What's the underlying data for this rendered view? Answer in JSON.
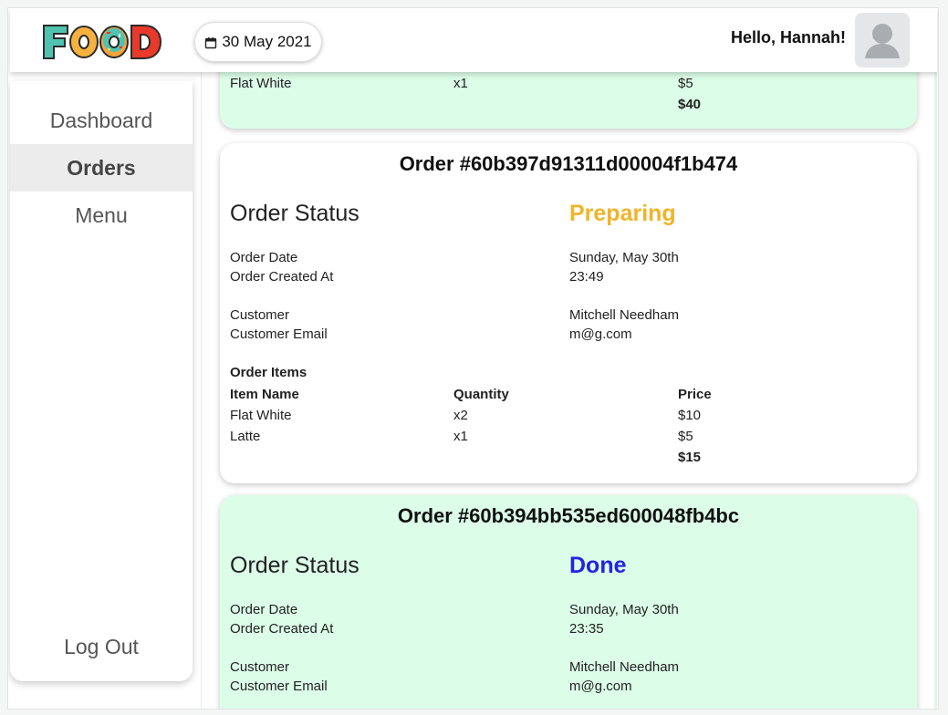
{
  "header": {
    "logo_text": "FOOD",
    "date": "30 May 2021",
    "greeting": "Hello, Hannah!"
  },
  "sidebar": {
    "items": [
      {
        "label": "Dashboard",
        "active": false
      },
      {
        "label": "Orders",
        "active": true
      },
      {
        "label": "Menu",
        "active": false
      }
    ],
    "logout_label": "Log Out"
  },
  "orders": [
    {
      "partial": true,
      "items": [
        {
          "name": "Flat White",
          "quantity": "x1",
          "price": "$5"
        }
      ],
      "total": "$40"
    },
    {
      "title": "Order #60b397d91311d00004f1b474",
      "status_label": "Order Status",
      "status": "Preparing",
      "status_color": "#f0b429",
      "order_date_label": "Order Date",
      "order_date": "Sunday, May 30th",
      "created_at_label": "Order Created At",
      "created_at": "23:49",
      "customer_label": "Customer",
      "customer": "Mitchell Needham",
      "email_label": "Customer Email",
      "email": "m@g.com",
      "items_heading": "Order Items",
      "columns": [
        "Item Name",
        "Quantity",
        "Price"
      ],
      "items": [
        {
          "name": "Flat White",
          "quantity": "x2",
          "price": "$10"
        },
        {
          "name": "Latte",
          "quantity": "x1",
          "price": "$5"
        }
      ],
      "total": "$15"
    },
    {
      "title": "Order #60b394bb535ed600048fb4bc",
      "status_label": "Order Status",
      "status": "Done",
      "status_color": "#2323e0",
      "order_date_label": "Order Date",
      "order_date": "Sunday, May 30th",
      "created_at_label": "Order Created At",
      "created_at": "23:35",
      "customer_label": "Customer",
      "customer": "Mitchell Needham",
      "email_label": "Customer Email",
      "email": "m@g.com"
    }
  ],
  "colors": {
    "done_card_bg": "#dcfde8",
    "preparing_card_bg": "#ffffff",
    "logo_f": "#4fc3b0",
    "logo_o1": "#f6b13e",
    "logo_o2": "#f6a23a",
    "logo_d": "#e8392b"
  }
}
